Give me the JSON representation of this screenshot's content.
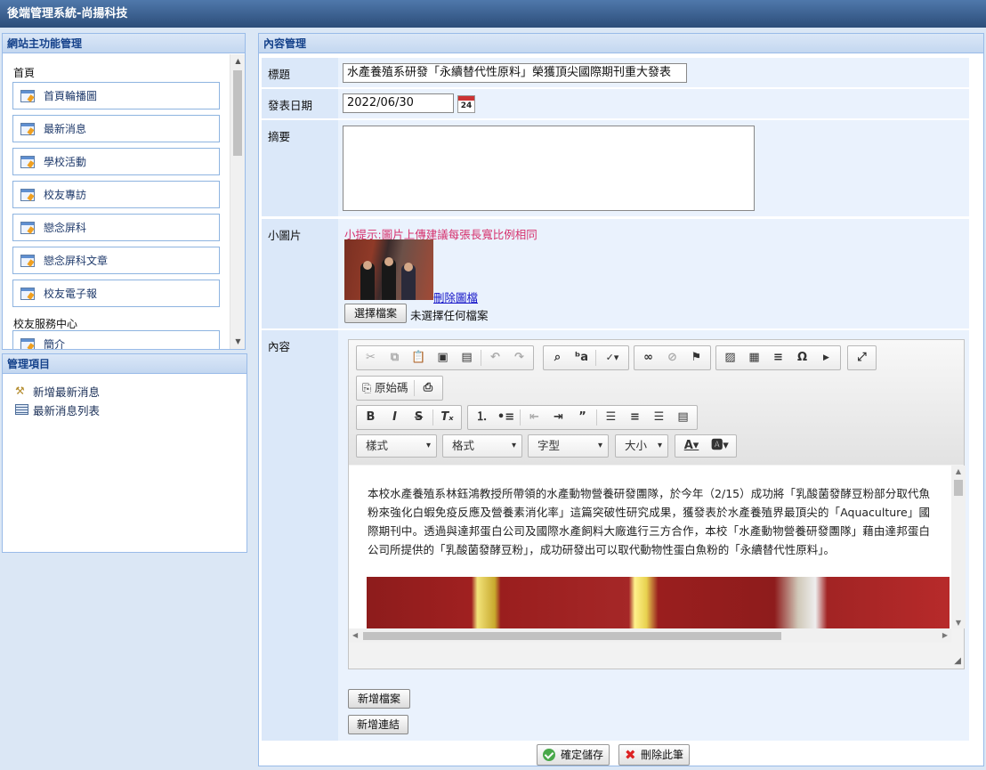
{
  "app": {
    "title": "後端管理系統-尚揚科技"
  },
  "nav": {
    "header": "網站主功能管理",
    "group1": "首頁",
    "items": [
      {
        "label": "首頁輪播圖"
      },
      {
        "label": "最新消息"
      },
      {
        "label": "學校活動"
      },
      {
        "label": "校友專訪"
      },
      {
        "label": "戀念屏科"
      },
      {
        "label": "戀念屏科文章"
      },
      {
        "label": "校友電子報"
      }
    ],
    "group2": "校友服務中心",
    "partial_item": "簡介"
  },
  "mgmt": {
    "header": "管理項目",
    "items": [
      {
        "label": "新增最新消息",
        "icon": "tools-icon"
      },
      {
        "label": "最新消息列表",
        "icon": "list-icon"
      }
    ]
  },
  "content": {
    "header": "內容管理",
    "title_label": "標題",
    "title_value": "水產養殖系研發「永續替代性原料」榮獲頂尖國際期刊重大發表",
    "date_label": "發表日期",
    "date_value": "2022/06/30",
    "calendar_day": "24",
    "summary_label": "摘要",
    "summary_value": "",
    "image_label": "小圖片",
    "image_hint": "小提示:圖片上傳建議每張長寬比例相同",
    "delete_image": "刪除圖檔",
    "choose_file": "選擇檔案",
    "no_file": "未選擇任何檔案",
    "body_label": "內容",
    "source_button": "原始碼",
    "combos": {
      "style": "樣式",
      "format": "格式",
      "font": "字型",
      "size": "大小"
    },
    "editor_text": "本校水產養殖系林鈺鴻教授所帶領的水產動物營養研發團隊，於今年（2/15）成功將「乳酸菌發酵豆粉部分取代魚粉來強化白蝦免疫反應及營養素消化率」這篇突破性研究成果，獲發表於水產養殖界最頂尖的「Aquaculture」國際期刊中。透過與達邦蛋白公司及國際水產飼料大廠進行三方合作，本校「水產動物營養研發團隊」藉由達邦蛋白公司所提供的「乳酸菌發酵豆粉」，成功研發出可以取代動物性蛋白魚粉的「永續替代性原料」。",
    "add_file": "新增檔案",
    "add_link": "新增連結",
    "save": "確定儲存",
    "delete": "刪除此筆"
  }
}
